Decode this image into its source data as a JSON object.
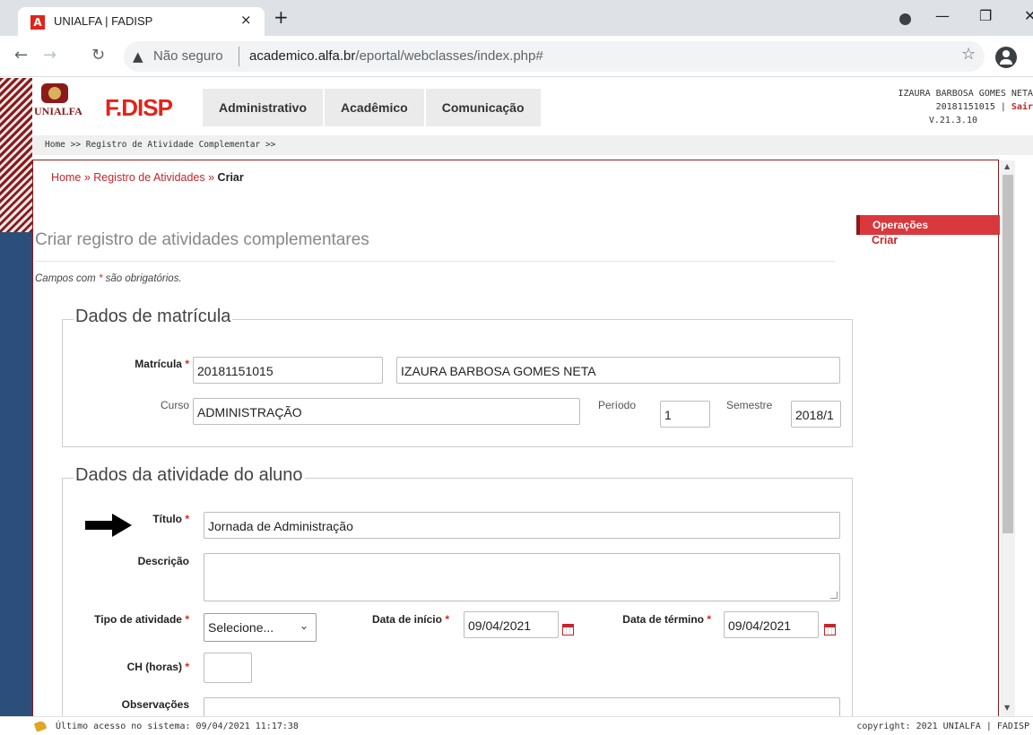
{
  "browser": {
    "tab_title": "UNIALFA | FADISP",
    "tab_close": "×",
    "new_tab": "+",
    "not_secure": "Não seguro",
    "url_host": "academico.alfa.br",
    "url_path": "/eportal/webclasses/index.php#",
    "favicon_letter": "A"
  },
  "header": {
    "logo_unialfa": "UNIALFA",
    "logo_fadisp": "F.DISP",
    "nav": [
      "Administrativo",
      "Acadêmico",
      "Comunicação"
    ],
    "user_name": "IZAURA BARBOSA GOMES NETA",
    "user_id": "20181151015",
    "logout": "Sair",
    "version": "V.21.3.10",
    "crumb": "Home >>  Registro de Atividade Complementar >>"
  },
  "content": {
    "breadcrumb_home": "Home",
    "breadcrumb_mid": "Registro de Atividades",
    "breadcrumb_current": "Criar",
    "page_title": "Criar registro de atividades complementares",
    "required_note_pre": "Campos com ",
    "required_note_ast": "*",
    "required_note_post": " são obrigatórios."
  },
  "operations": {
    "heading": "Operações",
    "create": "Criar"
  },
  "enrollment": {
    "legend": "Dados de matrícula",
    "matricula_label": "Matrícula",
    "matricula_value": "20181151015",
    "name_value": "IZAURA BARBOSA GOMES NETA",
    "curso_label": "Curso",
    "curso_value": "ADMINISTRAÇÃO",
    "periodo_label": "Período",
    "periodo_value": "1",
    "semestre_label": "Semestre",
    "semestre_value": "2018/1"
  },
  "activity": {
    "legend": "Dados da atividade do aluno",
    "titulo_label": "Título",
    "titulo_value": "Jornada de Administração",
    "descricao_label": "Descrição",
    "descricao_value": "",
    "tipo_label": "Tipo de atividade",
    "tipo_value": "Selecione...",
    "inicio_label": "Data de início",
    "inicio_value": "09/04/2021",
    "termino_label": "Data de término",
    "termino_value": "09/04/2021",
    "ch_label": "CH (horas)",
    "ch_value": "",
    "obs_label": "Observações",
    "required_mark": "*"
  },
  "status": {
    "last_access": "Último acesso no sistema: 09/04/2021 11:17:38",
    "copyright": "copyright: 2021 UNIALFA | FADISP"
  },
  "colors": {
    "brand_red": "#c1272d",
    "sidebar_blue": "#2b4f7a"
  }
}
